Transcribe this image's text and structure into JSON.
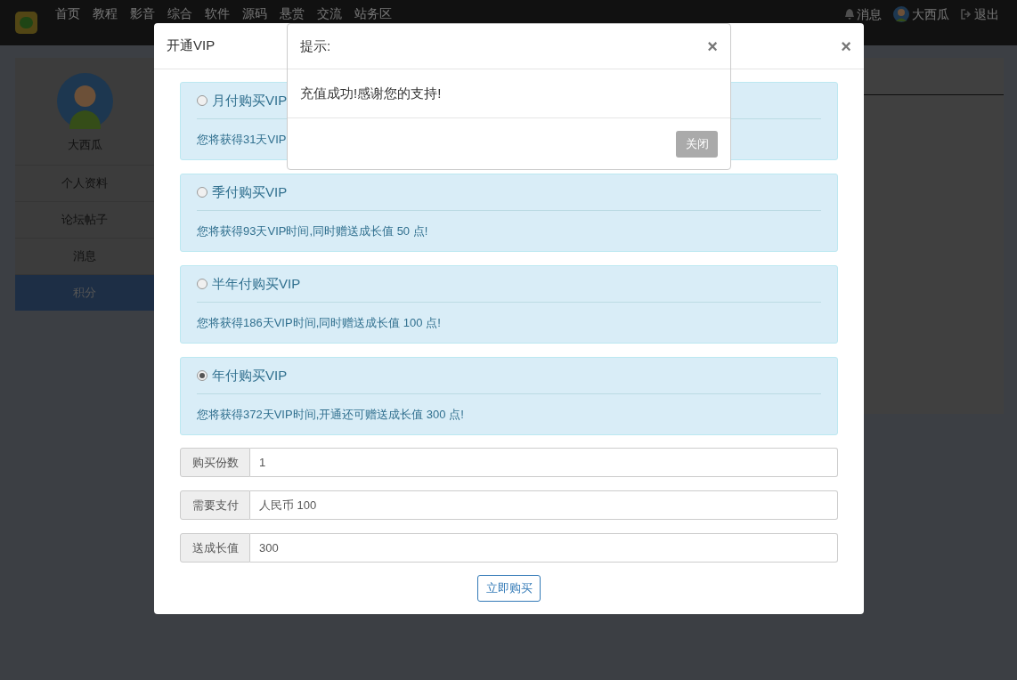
{
  "navbar": {
    "nav_items": [
      "首页",
      "教程",
      "影音",
      "综合",
      "软件",
      "源码",
      "悬赏",
      "交流",
      "站务区"
    ],
    "right_items": [
      {
        "kind": "notifications",
        "label": "消息"
      },
      {
        "kind": "user",
        "label": "大西瓜"
      },
      {
        "kind": "logout",
        "label": "退出"
      }
    ]
  },
  "sidebar": {
    "username": "大西瓜",
    "items": [
      {
        "label": "个人资料",
        "selected": false
      },
      {
        "label": "论坛帖子",
        "selected": false
      },
      {
        "label": "消息",
        "selected": false
      },
      {
        "label": "积分",
        "selected": true
      }
    ]
  },
  "vip_dialog": {
    "title": "开通VIP",
    "close": "×",
    "plans": [
      {
        "title": "月付购买VIP",
        "description": "您将获得31天VIP",
        "selected": false
      },
      {
        "title": "季付购买VIP",
        "description": "您将获得93天VIP时间,同时赠送成长值 50 点!",
        "selected": false
      },
      {
        "title": "半年付购买VIP",
        "description": "您将获得186天VIP时间,同时赠送成长值 100 点!",
        "selected": false
      },
      {
        "title": "年付购买VIP",
        "description": "您将获得372天VIP时间,开通还可赠送成长值 300 点!",
        "selected": true
      }
    ],
    "fields": [
      {
        "label": "购买份数",
        "value": "1"
      },
      {
        "label": "需要支付",
        "value": "人民币 100"
      },
      {
        "label": "送成长值",
        "value": "300"
      }
    ],
    "submit": "立即购买"
  },
  "alert_dialog": {
    "title": "提示:",
    "close": "×",
    "message": "充值成功!感谢您的支持!",
    "button": "关闭"
  }
}
